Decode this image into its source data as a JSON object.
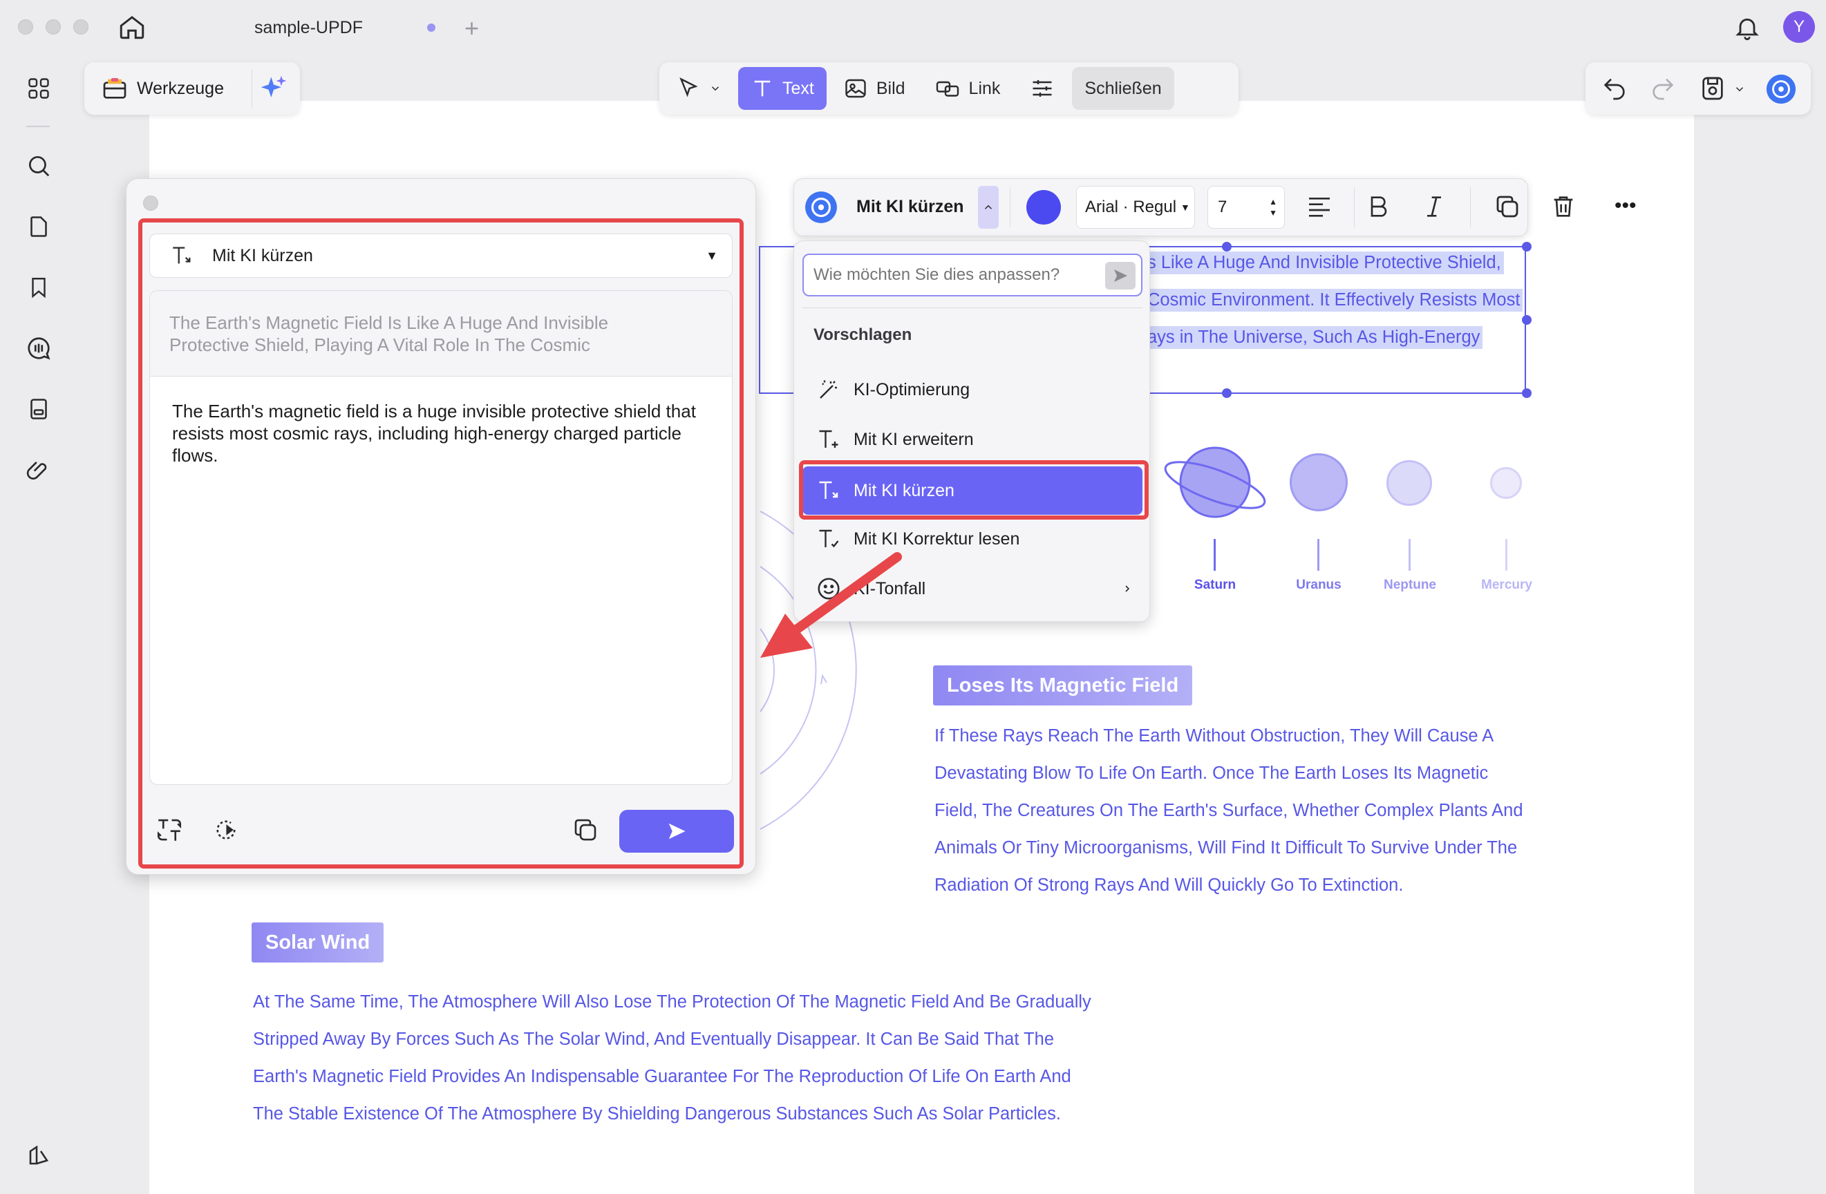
{
  "titlebar": {
    "tab_title": "sample-UPDF",
    "avatar_letter": "Y"
  },
  "left_toolbar": {
    "tools_label": "Werkzeuge"
  },
  "mode_toolbar": {
    "text_label": "Text",
    "image_label": "Bild",
    "link_label": "Link",
    "close_label": "Schließen"
  },
  "ai_panel": {
    "mode_label": "Mit KI kürzen",
    "original_text": "The Earth's Magnetic Field Is Like A Huge And Invisible Protective Shield, Playing A Vital Role In The Cosmic",
    "result_text": "The Earth's magnetic field is a huge invisible protective shield that resists most cosmic rays, including high-energy charged particle flows."
  },
  "edit_toolbar": {
    "ai_label": "Mit KI kürzen",
    "font_name": "Arial · Regul",
    "font_size": "7",
    "color": "#4b4af0"
  },
  "ai_menu": {
    "prompt_placeholder": "Wie möchten Sie dies anpassen?",
    "section_label": "Vorschlagen",
    "items": [
      {
        "label": "KI-Optimierung",
        "icon": "magic-wand-icon"
      },
      {
        "label": "Mit KI erweitern",
        "icon": "text-expand-icon"
      },
      {
        "label": "Mit KI kürzen",
        "icon": "text-shorten-icon"
      },
      {
        "label": "Mit KI Korrektur lesen",
        "icon": "text-proofread-icon"
      },
      {
        "label": "KI-Tonfall",
        "icon": "smiley-icon"
      }
    ]
  },
  "document": {
    "selected_lines": [
      "s Like A Huge And Invisible Protective Shield,",
      "Cosmic Environment. It Effectively Resists Most",
      "ays in The Universe, Such As High-Energy"
    ],
    "planets": [
      "Saturn",
      "Uranus",
      "Neptune",
      "Mercury"
    ],
    "section1": {
      "heading": "Loses Its Magnetic Field",
      "lines": [
        "If These Rays Reach The Earth Without Obstruction, They Will Cause A",
        "Devastating Blow To Life On Earth. Once The Earth Loses Its Magnetic",
        "Field, The Creatures On The Earth's Surface, Whether Complex Plants And",
        "Animals Or Tiny Microorganisms, Will Find It Difficult To Survive Under The",
        "Radiation Of Strong Rays And Will Quickly Go To Extinction."
      ]
    },
    "section2": {
      "heading": "Solar Wind",
      "lines": [
        "At The Same Time, The Atmosphere Will Also Lose The Protection Of The Magnetic Field And Be Gradually",
        "Stripped Away By Forces Such As The Solar Wind, And Eventually Disappear. It Can Be Said That The",
        "Earth's Magnetic Field Provides An Indispensable Guarantee For The Reproduction Of Life On Earth And",
        "The Stable Existence Of The Atmosphere By Shielding Dangerous Substances Such As Solar Particles."
      ]
    }
  },
  "colors": {
    "accent": "#6a64f4",
    "doc_text": "#5757e6",
    "highlight": "#e7474a"
  }
}
